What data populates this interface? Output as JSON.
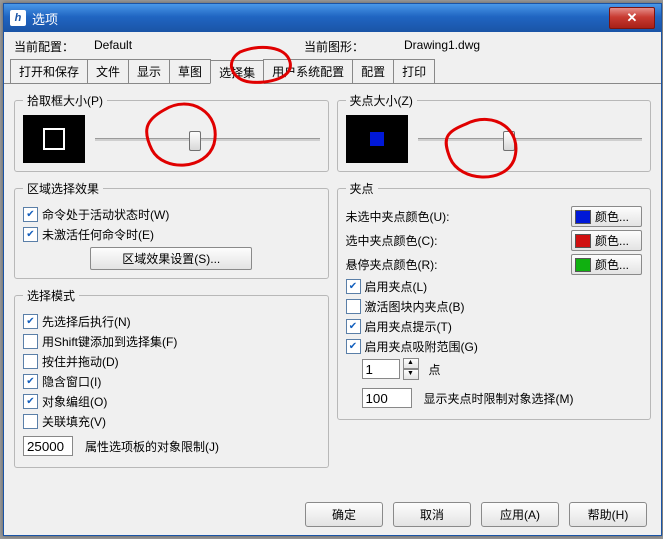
{
  "window": {
    "title": "选项"
  },
  "info": {
    "config_label": "当前配置：",
    "config_value": "Default",
    "drawing_label": "当前图形：",
    "drawing_value": "Drawing1.dwg"
  },
  "tabs": {
    "t0": "打开和保存",
    "t1": "文件",
    "t2": "显示",
    "t3": "草图",
    "t4": "选择集",
    "t5": "用户系统配置",
    "t6": "配置",
    "t7": "打印"
  },
  "pickbox": {
    "legend": "拾取框大小(P)"
  },
  "region": {
    "legend": "区域选择效果",
    "c1": "命令处于活动状态时(W)",
    "c2": "未激活任何命令时(E)",
    "btn": "区域效果设置(S)..."
  },
  "selmode": {
    "legend": "选择模式",
    "m1": "先选择后执行(N)",
    "m2": "用Shift键添加到选择集(F)",
    "m3": "按住并拖动(D)",
    "m4": "隐含窗口(I)",
    "m5": "对象编组(O)",
    "m6": "关联填充(V)",
    "limit_val": "25000",
    "limit_label": "属性选项板的对象限制(J)"
  },
  "gripsize": {
    "legend": "夹点大小(Z)"
  },
  "grips": {
    "legend": "夹点",
    "unsel_label": "未选中夹点颜色(U):",
    "unsel_btn": "颜色...",
    "unsel_color": "#0018d8",
    "sel_label": "选中夹点颜色(C):",
    "sel_btn": "颜色...",
    "sel_color": "#d01010",
    "hover_label": "悬停夹点颜色(R):",
    "hover_btn": "颜色...",
    "hover_color": "#10b010",
    "g1": "启用夹点(L)",
    "g2": "激活图块内夹点(B)",
    "g3": "启用夹点提示(T)",
    "g4": "启用夹点吸附范围(G)",
    "snap_val": "1",
    "snap_unit": "点",
    "lim_val": "100",
    "lim_label": "显示夹点时限制对象选择(M)"
  },
  "buttons": {
    "ok": "确定",
    "cancel": "取消",
    "apply": "应用(A)",
    "help": "帮助(H)"
  }
}
